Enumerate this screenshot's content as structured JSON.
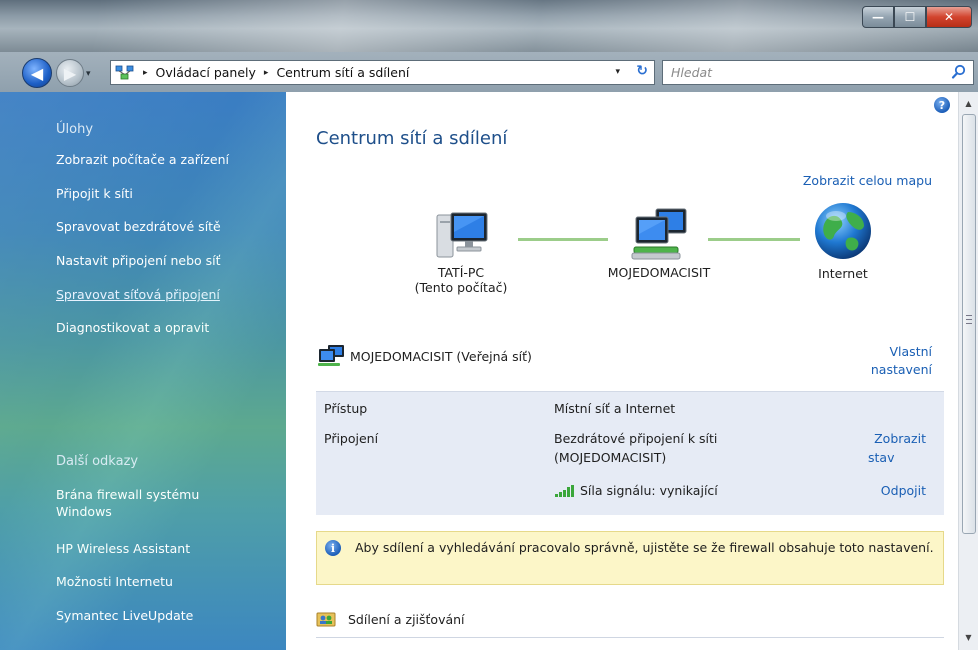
{
  "window": {
    "controls": {
      "minimize": "—",
      "maximize": "☐",
      "close": "✕"
    }
  },
  "navigation": {
    "back_symbol": "◀",
    "forward_symbol": "▶",
    "recent_symbol": "▾",
    "breadcrumb": [
      "Ovládací panely",
      "Centrum sítí a sdílení"
    ],
    "crumb_separator": "▸",
    "dropdown_symbol": "▾",
    "refresh_symbol": "↻",
    "search_placeholder": "Hledat"
  },
  "sidebar": {
    "tasks_heading": "Úlohy",
    "tasks": [
      {
        "label": "Zobrazit počítače a zařízení"
      },
      {
        "label": "Připojit k síti"
      },
      {
        "label": "Spravovat bezdrátové sítě"
      },
      {
        "label": "Nastavit připojení nebo síť"
      },
      {
        "label": "Spravovat síťová připojení"
      },
      {
        "label": "Diagnostikovat a opravit"
      }
    ],
    "other_heading": "Další odkazy",
    "other_links": [
      {
        "label": "Brána firewall systému Windows"
      },
      {
        "label": "HP Wireless Assistant"
      },
      {
        "label": "Možnosti Internetu"
      },
      {
        "label": "Symantec LiveUpdate"
      }
    ]
  },
  "main": {
    "help_symbol": "?",
    "title": "Centrum sítí a sdílení",
    "view_full_map": "Zobrazit celou mapu",
    "map": {
      "computer_name": "TATÍ-PC",
      "computer_subtitle": "(Tento počítač)",
      "network_name": "MOJEDOMACISIT",
      "internet_label": "Internet"
    },
    "network": {
      "name": "MOJEDOMACISIT (Veřejná síť)",
      "customize_link": "Vlastní nastavení",
      "access_label": "Přístup",
      "access_value": "Místní síť a Internet",
      "connection_label": "Připojení",
      "connection_value_line1": "Bezdrátové připojení k síti",
      "connection_value_line2": "(MOJEDOMACISIT)",
      "view_status_link_line1": "Zobrazit",
      "view_status_link_line2": "stav",
      "signal_text": "Síla signálu: vynikající",
      "disconnect_link": "Odpojit"
    },
    "info_symbol": "i",
    "info_message": "Aby sdílení a vyhledávání pracovalo správně, ujistěte se že firewall obsahuje toto nastavení.",
    "sharing_heading": "Sdílení a zjišťování"
  },
  "scrollbar": {
    "up_symbol": "▲",
    "down_symbol": "▼"
  },
  "colors": {
    "link": "#1a5fb4",
    "title": "#1e4f8a",
    "connection_line": "#9ccd8a",
    "info_background": "#fcf6c8",
    "details_background": "#e6ebf5"
  }
}
